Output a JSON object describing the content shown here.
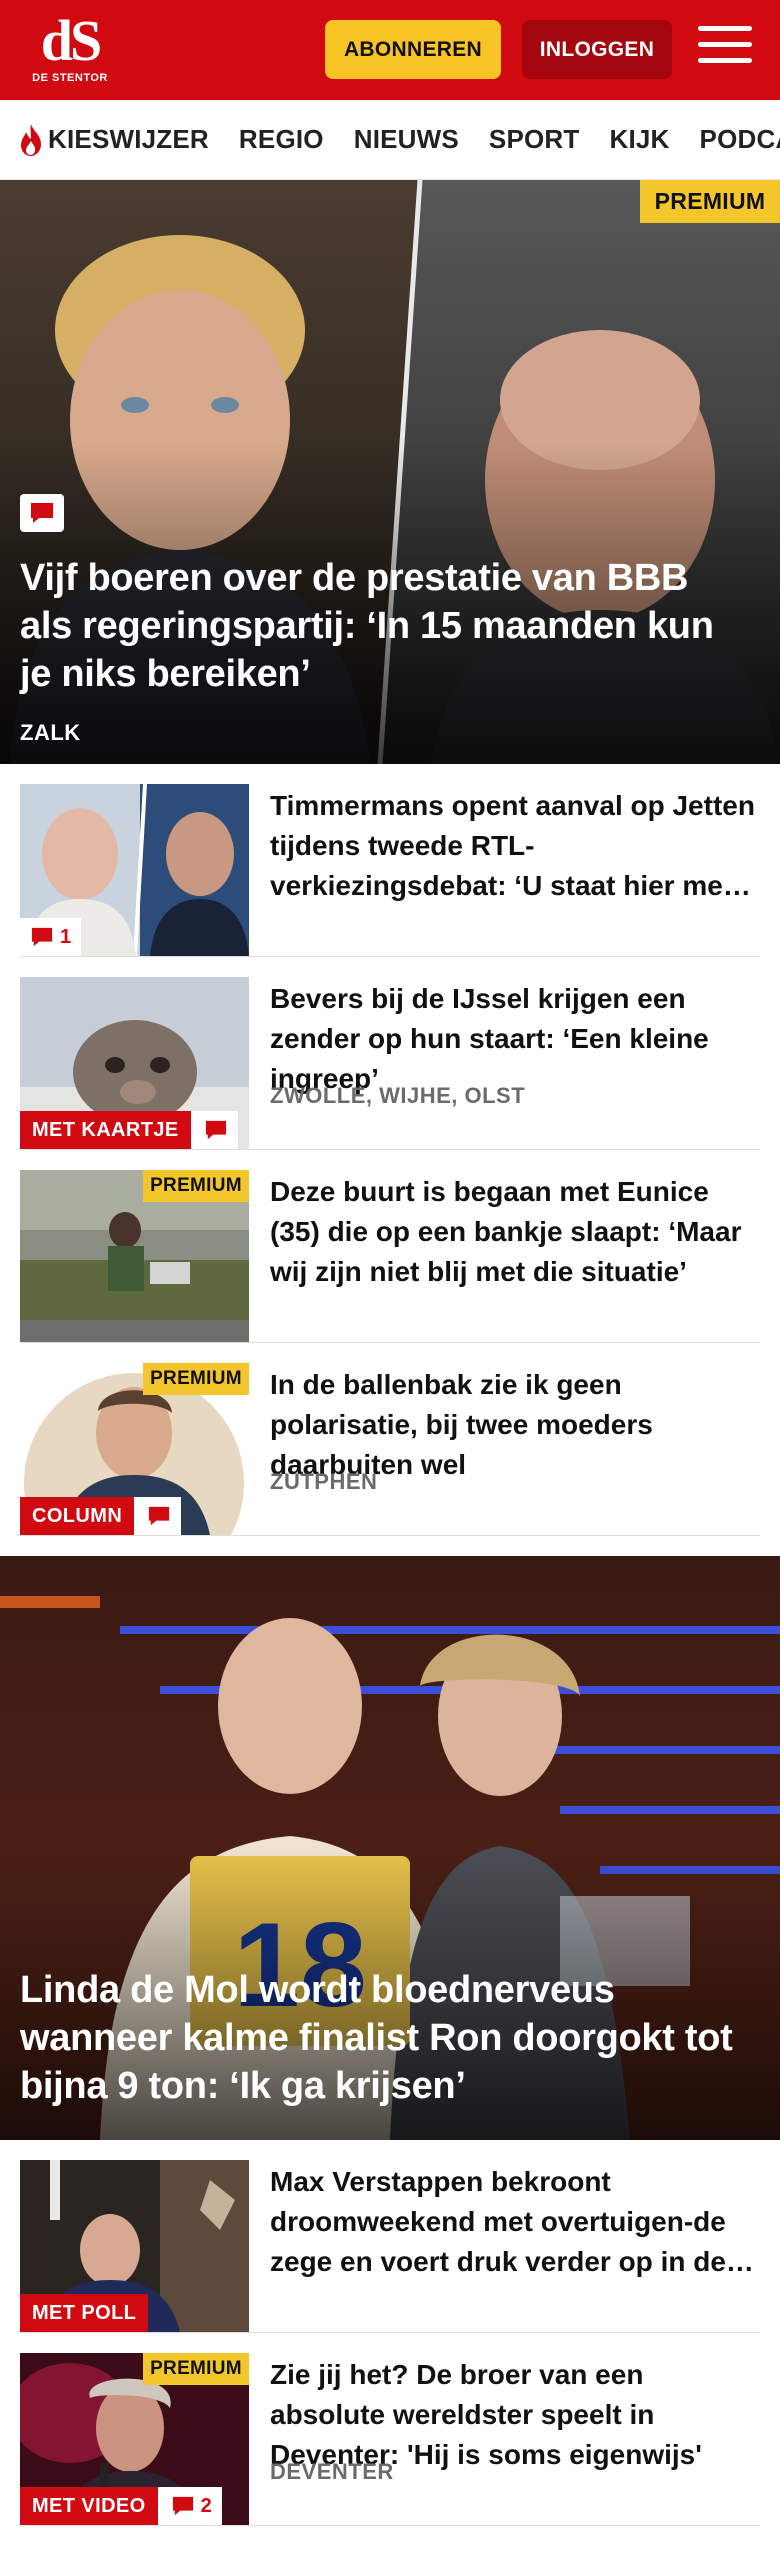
{
  "header": {
    "logo_text": "dS",
    "logo_sub": "DE STENTOR",
    "subscribe_label": "ABONNEREN",
    "login_label": "INLOGGEN"
  },
  "nav": {
    "items": [
      {
        "label": "KIESWIJZER",
        "icon": "flame-icon"
      },
      {
        "label": "REGIO"
      },
      {
        "label": "NIEUWS"
      },
      {
        "label": "SPORT"
      },
      {
        "label": "KIJK"
      },
      {
        "label": "PODCAST"
      }
    ]
  },
  "hero": {
    "premium": "PREMIUM",
    "title": "Vijf boeren over de prestatie van BBB als regeringspartij: ‘In 15 maanden kun je niks bereiken’",
    "location": "ZALK",
    "icon": "comment-icon"
  },
  "articles": [
    {
      "title": "Timmermans opent aanval op Jetten tijdens tweede RTL-verkiezingsdebat: ‘U staat hier met een mond vol…",
      "comment_count": "1"
    },
    {
      "title": "Bevers bij de IJssel krijgen een zender op hun staart: ‘Een kleine ingreep’",
      "location": "ZWOLLE, WIJHE, OLST",
      "badge": "MET KAARTJE"
    },
    {
      "premium": "PREMIUM",
      "title": "Deze buurt is begaan met Eunice (35) die op een bankje slaapt: ‘Maar wij zijn niet blij met die situatie’"
    },
    {
      "premium": "PREMIUM",
      "title": "In de ballenbak zie ik geen polarisatie, bij twee moeders daarbuiten wel",
      "location": "ZUTPHEN",
      "badge": "COLUMN"
    }
  ],
  "hero2": {
    "title": "Linda de Mol wordt bloednerveus wanneer kalme finalist Ron doorgokt tot bijna 9 ton: ‘Ik ga krijsen’",
    "podium_number": "18"
  },
  "articles2": [
    {
      "title": "Max Verstappen bekroont droomweekend met overtuigen-de zege en voert druk verder op in de titelstrijd",
      "badge": "MET POLL"
    },
    {
      "premium": "PREMIUM",
      "title": "Zie jij het? De broer van een absolute wereldster speelt in Deventer: 'Hij is soms eigenwijs'",
      "location": "DEVENTER",
      "badge": "MET VIDEO",
      "comment_count": "2"
    }
  ],
  "colors": {
    "brand_red": "#d10a11",
    "login_red": "#a3060c",
    "premium_yellow": "#f3c72c",
    "subscribe_yellow": "#f7c325"
  }
}
